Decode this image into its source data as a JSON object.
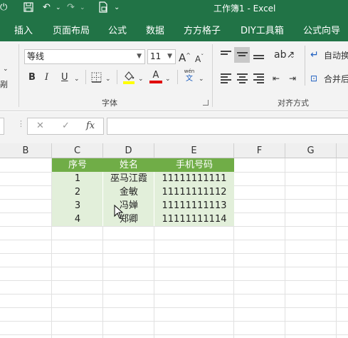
{
  "app": {
    "window_title": "工作簿1 - Excel"
  },
  "tabs": [
    "插入",
    "页面布局",
    "公式",
    "数据",
    "方方格子",
    "DIY工具箱",
    "公式向导"
  ],
  "ribbon": {
    "font_name": "等线",
    "font_size": "11",
    "grow_font": "A",
    "shrink_font": "A",
    "bold": "B",
    "italic": "I",
    "underline": "U",
    "font_color_letter": "A",
    "phonetic_top": "wén",
    "phonetic_bottom": "文",
    "font_group_label": "字体",
    "align_group_label": "对齐方式",
    "wrap_text": "自动换",
    "merge_center": "合并后",
    "left_edge_label": "剐",
    "fill_color": "#ffff00",
    "font_color": "#e00000"
  },
  "formula_bar": {
    "cancel": "✕",
    "enter": "✓",
    "fx": "fx",
    "value": ""
  },
  "grid": {
    "columns": [
      "B",
      "C",
      "D",
      "E",
      "F",
      "G"
    ],
    "table": {
      "headers": [
        "序号",
        "姓名",
        "手机号码"
      ],
      "rows": [
        [
          "1",
          "巫马江霞",
          "11111111111"
        ],
        [
          "2",
          "金敏",
          "11111111112"
        ],
        [
          "3",
          "冯婵",
          "11111111113"
        ],
        [
          "4",
          "郑卿",
          "11111111114"
        ]
      ]
    },
    "header_color": "#70ad47",
    "band_color": "#e2efda"
  }
}
